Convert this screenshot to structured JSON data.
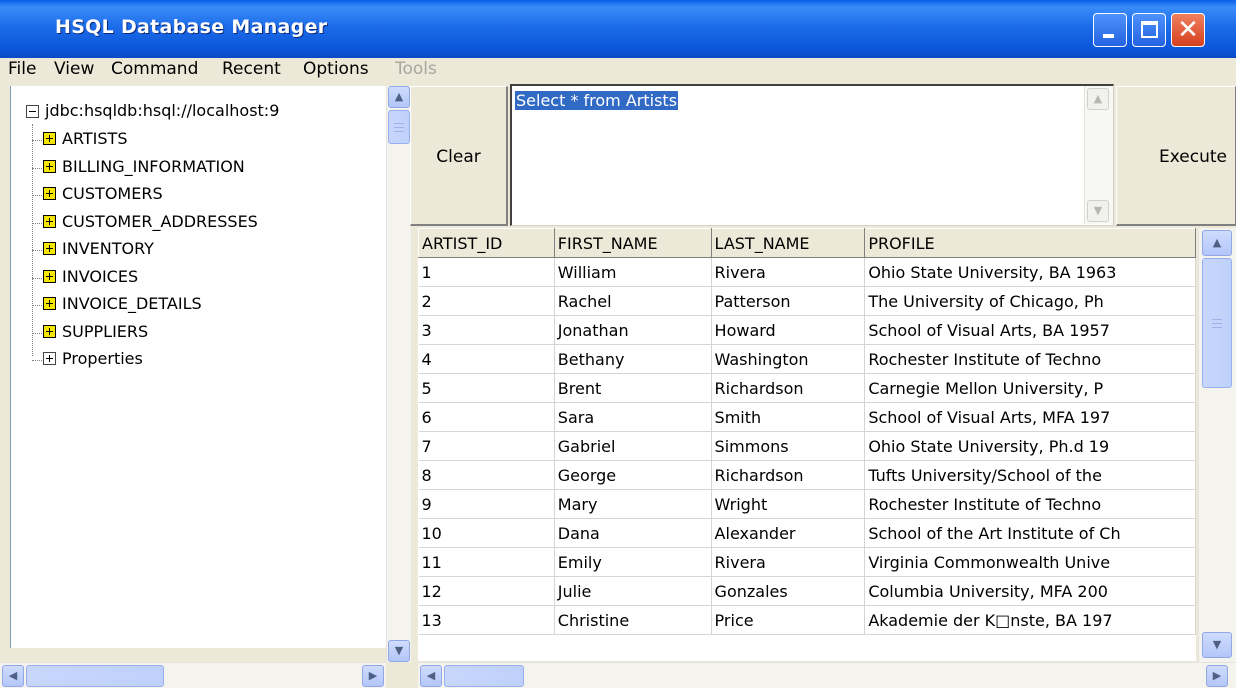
{
  "window": {
    "title": "HSQL Database Manager"
  },
  "menubar": {
    "items": [
      {
        "label": "File",
        "enabled": true
      },
      {
        "label": "View",
        "enabled": true
      },
      {
        "label": "Command",
        "enabled": true
      },
      {
        "label": "Recent",
        "enabled": true
      },
      {
        "label": "Options",
        "enabled": true
      },
      {
        "label": "Tools",
        "enabled": false
      }
    ]
  },
  "tree": {
    "root": "jdbc:hsqldb:hsql://localhost:9",
    "items": [
      {
        "label": "ARTISTS",
        "type": "table"
      },
      {
        "label": "BILLING_INFORMATION",
        "type": "table"
      },
      {
        "label": "CUSTOMERS",
        "type": "table"
      },
      {
        "label": "CUSTOMER_ADDRESSES",
        "type": "table"
      },
      {
        "label": "INVENTORY",
        "type": "table"
      },
      {
        "label": "INVOICES",
        "type": "table"
      },
      {
        "label": "INVOICE_DETAILS",
        "type": "table"
      },
      {
        "label": "SUPPLIERS",
        "type": "table"
      },
      {
        "label": "Properties",
        "type": "properties"
      }
    ]
  },
  "query": {
    "clear_label": "Clear",
    "execute_label": "Execute",
    "sql": "Select * from Artists"
  },
  "results": {
    "columns": [
      "ARTIST_ID",
      "FIRST_NAME",
      "LAST_NAME",
      "PROFILE"
    ],
    "rows": [
      [
        "1",
        "William",
        "Rivera",
        "Ohio State University, BA 1963"
      ],
      [
        "2",
        "Rachel",
        "Patterson",
        "The University of Chicago, Ph"
      ],
      [
        "3",
        "Jonathan",
        "Howard",
        "School of Visual Arts, BA 1957"
      ],
      [
        "4",
        "Bethany",
        "Washington",
        "Rochester Institute of Techno"
      ],
      [
        "5",
        "Brent",
        "Richardson",
        "Carnegie Mellon University, P"
      ],
      [
        "6",
        "Sara",
        "Smith",
        "School of Visual Arts, MFA 197"
      ],
      [
        "7",
        "Gabriel",
        "Simmons",
        "Ohio State University, Ph.d 19"
      ],
      [
        "8",
        "George",
        "Richardson",
        "Tufts University/School of the"
      ],
      [
        "9",
        "Mary",
        "Wright",
        "Rochester Institute of Techno"
      ],
      [
        "10",
        "Dana",
        "Alexander",
        "School of the Art Institute of Ch"
      ],
      [
        "11",
        "Emily",
        "Rivera",
        "Virginia Commonwealth Unive"
      ],
      [
        "12",
        "Julie",
        "Gonzales",
        "Columbia University, MFA 200"
      ],
      [
        "13",
        "Christine",
        "Price",
        "Akademie der K□nste, BA 197"
      ]
    ]
  },
  "icons": {
    "minimize": "minimize-icon",
    "maximize": "maximize-icon",
    "close": "close-icon",
    "expand": "plus-box-icon",
    "collapse": "minus-box-icon"
  },
  "colors": {
    "titlebar": "#0b55da",
    "close_button": "#d4401e",
    "selection": "#316ac5",
    "table_icon": "#f5e600"
  }
}
